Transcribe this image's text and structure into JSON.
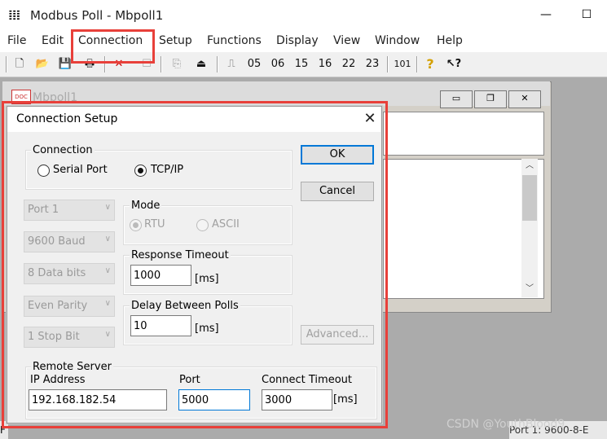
{
  "window": {
    "title": "Modbus Poll - Mbpoll1",
    "min_glyph": "—",
    "max_glyph": "☐",
    "icon": "modbus-app-icon"
  },
  "menu": [
    "File",
    "Edit",
    "Connection",
    "Setup",
    "Functions",
    "Display",
    "View",
    "Window",
    "Help"
  ],
  "toolbar": {
    "codes": [
      "05",
      "06",
      "15",
      "16",
      "22",
      "23"
    ],
    "code_101": "101",
    "help_glyph": "?",
    "whatsthis_glyph": "↖?"
  },
  "child": {
    "title": "Mbpoll1",
    "icon_text": "DOC"
  },
  "dialog": {
    "title": "Connection Setup",
    "close_glyph": "✕",
    "connection": {
      "label": "Connection",
      "serial": "Serial Port",
      "tcp": "TCP/IP",
      "selected": "TCP/IP"
    },
    "combos": [
      "Port 1",
      "9600 Baud",
      "8 Data bits",
      "Even Parity",
      "1 Stop Bit"
    ],
    "mode": {
      "label": "Mode",
      "rtu": "RTU",
      "ascii": "ASCII",
      "selected": "RTU"
    },
    "response_timeout": {
      "label": "Response Timeout",
      "value": "1000",
      "unit": "[ms]"
    },
    "delay_polls": {
      "label": "Delay Between Polls",
      "value": "10",
      "unit": "[ms]"
    },
    "remote": {
      "label": "Remote Server",
      "ip_label": "IP Address",
      "ip_value": "192.168.182.54",
      "port_label": "Port",
      "port_value": "5000",
      "timeout_label": "Connect Timeout",
      "timeout_value": "3000",
      "timeout_unit": "[ms]"
    },
    "buttons": {
      "ok": "OK",
      "cancel": "Cancel",
      "advanced": "Advanced..."
    }
  },
  "status": {
    "right": "Port 1: 9600-8-E",
    "left": "F"
  },
  "watermark": "CSDN @YouthBlood9",
  "colors": {
    "highlight": "#e8403a",
    "focus": "#0078d7"
  }
}
